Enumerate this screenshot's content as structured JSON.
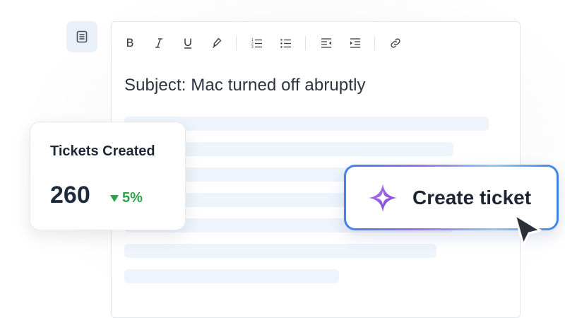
{
  "editor": {
    "subject": "Subject: Mac turned off abruptly",
    "toolbar": [
      {
        "name": "bold-icon",
        "glyph": "B"
      },
      {
        "name": "italic-icon",
        "glyph": "I"
      },
      {
        "name": "underline-icon",
        "glyph": "U"
      },
      {
        "name": "highlight-icon",
        "glyph": ""
      },
      {
        "name": "numbered-list-icon",
        "glyph": ""
      },
      {
        "name": "bullet-list-icon",
        "glyph": ""
      },
      {
        "name": "outdent-icon",
        "glyph": ""
      },
      {
        "name": "indent-icon",
        "glyph": ""
      },
      {
        "name": "link-icon",
        "glyph": ""
      }
    ]
  },
  "stats": {
    "title": "Tickets Created",
    "value": "260",
    "change": "5%",
    "change_direction": "down",
    "change_color": "#2fa14a"
  },
  "cta": {
    "label": "Create ticket",
    "icon": "sparkle-icon",
    "accent_colors": [
      "#3f82e8",
      "#9b72e6",
      "#8fc9f2"
    ]
  }
}
